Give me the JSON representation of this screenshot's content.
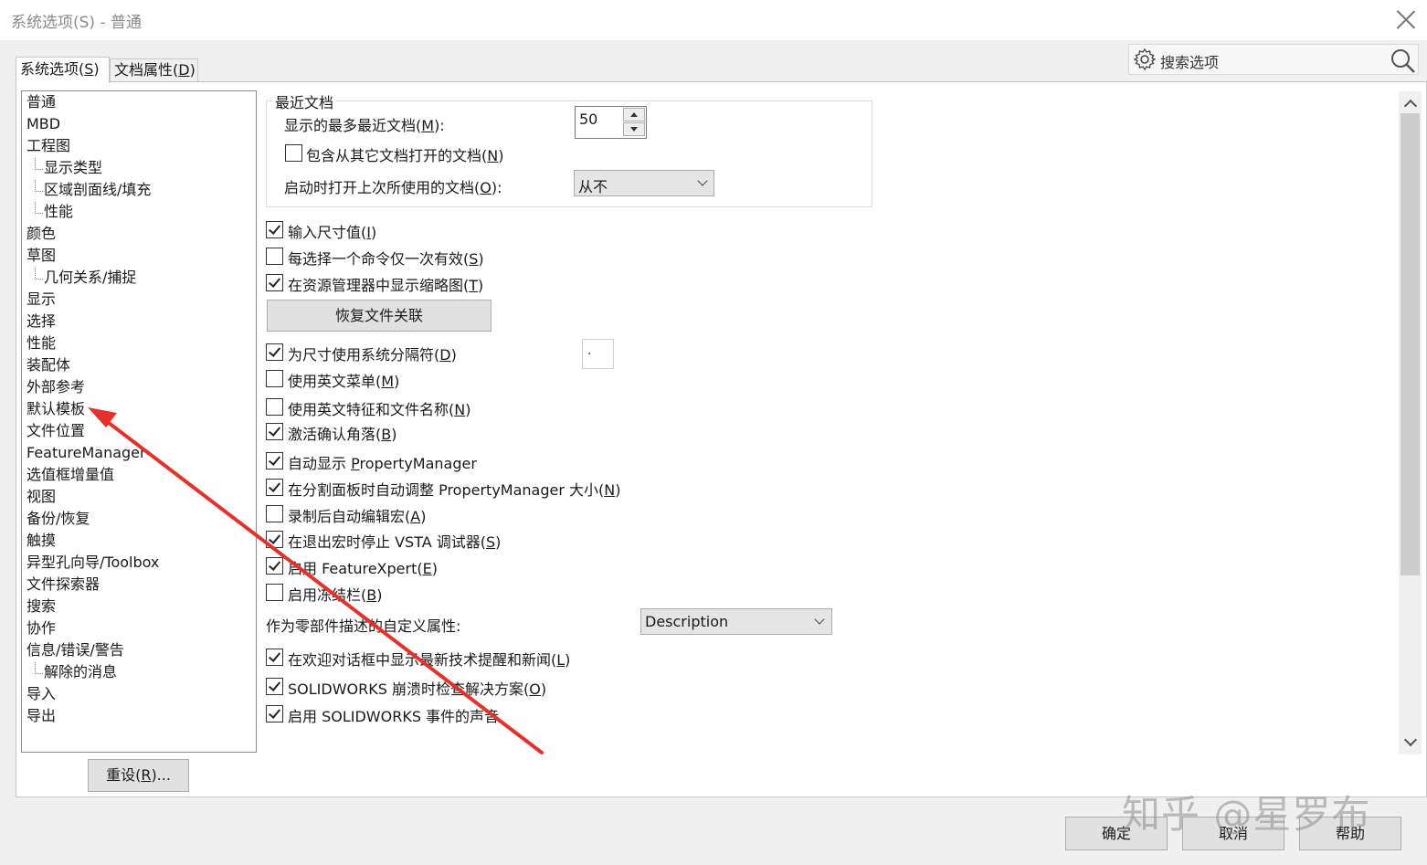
{
  "window": {
    "title": "系统选项(S) - 普通",
    "close_icon": "close-icon"
  },
  "search": {
    "placeholder": "搜索选项",
    "icon": "gear-icon",
    "search_icon": "search-icon"
  },
  "tabs": [
    {
      "label": "系统选项(",
      "mnemonic": "S",
      "suffix": ")",
      "active": true
    },
    {
      "label": "文档属性(",
      "mnemonic": "D",
      "suffix": ")",
      "active": false
    }
  ],
  "tree": {
    "items": [
      {
        "label": "普通",
        "level": 0
      },
      {
        "label": "MBD",
        "level": 0
      },
      {
        "label": "工程图",
        "level": 0
      },
      {
        "label": "显示类型",
        "level": 1
      },
      {
        "label": "区域剖面线/填充",
        "level": 1
      },
      {
        "label": "性能",
        "level": 1
      },
      {
        "label": "颜色",
        "level": 0
      },
      {
        "label": "草图",
        "level": 0
      },
      {
        "label": "几何关系/捕捉",
        "level": 1
      },
      {
        "label": "显示",
        "level": 0
      },
      {
        "label": "选择",
        "level": 0
      },
      {
        "label": "性能",
        "level": 0
      },
      {
        "label": "装配体",
        "level": 0
      },
      {
        "label": "外部参考",
        "level": 0
      },
      {
        "label": "默认模板",
        "level": 0
      },
      {
        "label": "文件位置",
        "level": 0
      },
      {
        "label": "FeatureManager",
        "level": 0
      },
      {
        "label": "选值框增量值",
        "level": 0
      },
      {
        "label": "视图",
        "level": 0
      },
      {
        "label": "备份/恢复",
        "level": 0
      },
      {
        "label": "触摸",
        "level": 0
      },
      {
        "label": "异型孔向导/Toolbox",
        "level": 0
      },
      {
        "label": "文件探索器",
        "level": 0
      },
      {
        "label": "搜索",
        "level": 0
      },
      {
        "label": "协作",
        "level": 0
      },
      {
        "label": "信息/错误/警告",
        "level": 0
      },
      {
        "label": "解除的消息",
        "level": 1
      },
      {
        "label": "导入",
        "level": 0
      },
      {
        "label": "导出",
        "level": 0
      }
    ],
    "reset_label": "重设(",
    "reset_mnemonic": "R",
    "reset_suffix": ")..."
  },
  "recent_docs": {
    "group_title": "最近文档",
    "max_label": "显示的最多最近文档(",
    "max_mnemonic": "M",
    "max_suffix": "):",
    "max_value": "50",
    "include_label": "包含从其它文档打开的文档(",
    "include_mnemonic": "N",
    "include_suffix": ")",
    "include_checked": false,
    "open_last_label": "启动时打开上次所使用的文档(",
    "open_last_mnemonic": "O",
    "open_last_suffix": "):",
    "open_last_value": "从不"
  },
  "options": [
    {
      "pre": "输入尺寸值(",
      "mn": "I",
      "post": ")",
      "checked": true
    },
    {
      "pre": "每选择一个命令仅一次有效(",
      "mn": "S",
      "post": ")",
      "checked": false
    },
    {
      "pre": "在资源管理器中显示缩略图(",
      "mn": "T",
      "post": ")",
      "checked": true
    },
    {
      "pre": "为尺寸使用系统分隔符(",
      "mn": "D",
      "post": ")",
      "checked": true
    },
    {
      "pre": "使用英文菜单(",
      "mn": "M",
      "post": ")",
      "checked": false
    },
    {
      "pre": "使用英文特征和文件名称(",
      "mn": "N",
      "post": ")",
      "checked": false
    },
    {
      "pre": "激活确认角落(",
      "mn": "B",
      "post": ")",
      "checked": true
    },
    {
      "pre": "自动显示 ",
      "mn": "P",
      "post": "ropertyManager",
      "checked": true
    },
    {
      "pre": "在分割面板时自动调整 PropertyManager 大小(",
      "mn": "N",
      "post": ")",
      "checked": true
    },
    {
      "pre": "录制后自动编辑宏(",
      "mn": "A",
      "post": ")",
      "checked": false
    },
    {
      "pre": "在退出宏时停止 VSTA 调试器(",
      "mn": "S",
      "post": ")",
      "checked": true
    },
    {
      "pre": "启用 FeatureXpert(",
      "mn": "E",
      "post": ")",
      "checked": true
    },
    {
      "pre": "启用冻结栏(",
      "mn": "B",
      "post": ")",
      "checked": false
    },
    {
      "pre": "在欢迎对话框中显示最新技术提醒和新闻(",
      "mn": "L",
      "post": ")",
      "checked": true
    },
    {
      "pre": "SOLIDWORKS 崩溃时检查解决方案(",
      "mn": "O",
      "post": ")",
      "checked": true
    },
    {
      "pre": "启用 SOLIDWORKS 事件的声音",
      "mn": "",
      "post": "",
      "checked": true
    }
  ],
  "restore_button": "恢复文件关联",
  "separator_value": ".",
  "custom_prop": {
    "label": "作为零部件描述的自定义属性:",
    "value": "Description"
  },
  "footer": {
    "ok": "确定",
    "cancel": "取消",
    "help": "帮助"
  },
  "watermark": "知乎 @星罗布",
  "colors": {
    "arrow": "#e8302a"
  }
}
